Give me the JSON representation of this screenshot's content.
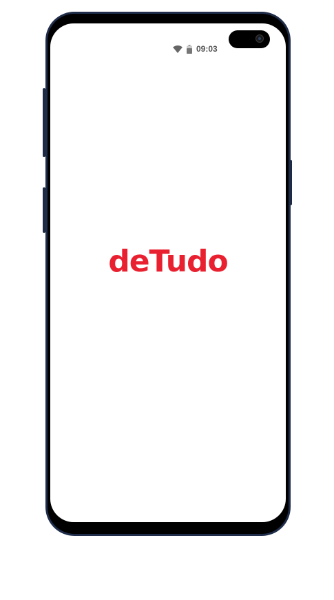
{
  "status_bar": {
    "time": "09:03",
    "wifi_icon": "wifi-icon",
    "battery_icon": "battery-icon"
  },
  "splash": {
    "logo_text": "deTudo",
    "brand_color": "#e8202f"
  },
  "device": {
    "frame_color": "#1f2d4a"
  }
}
